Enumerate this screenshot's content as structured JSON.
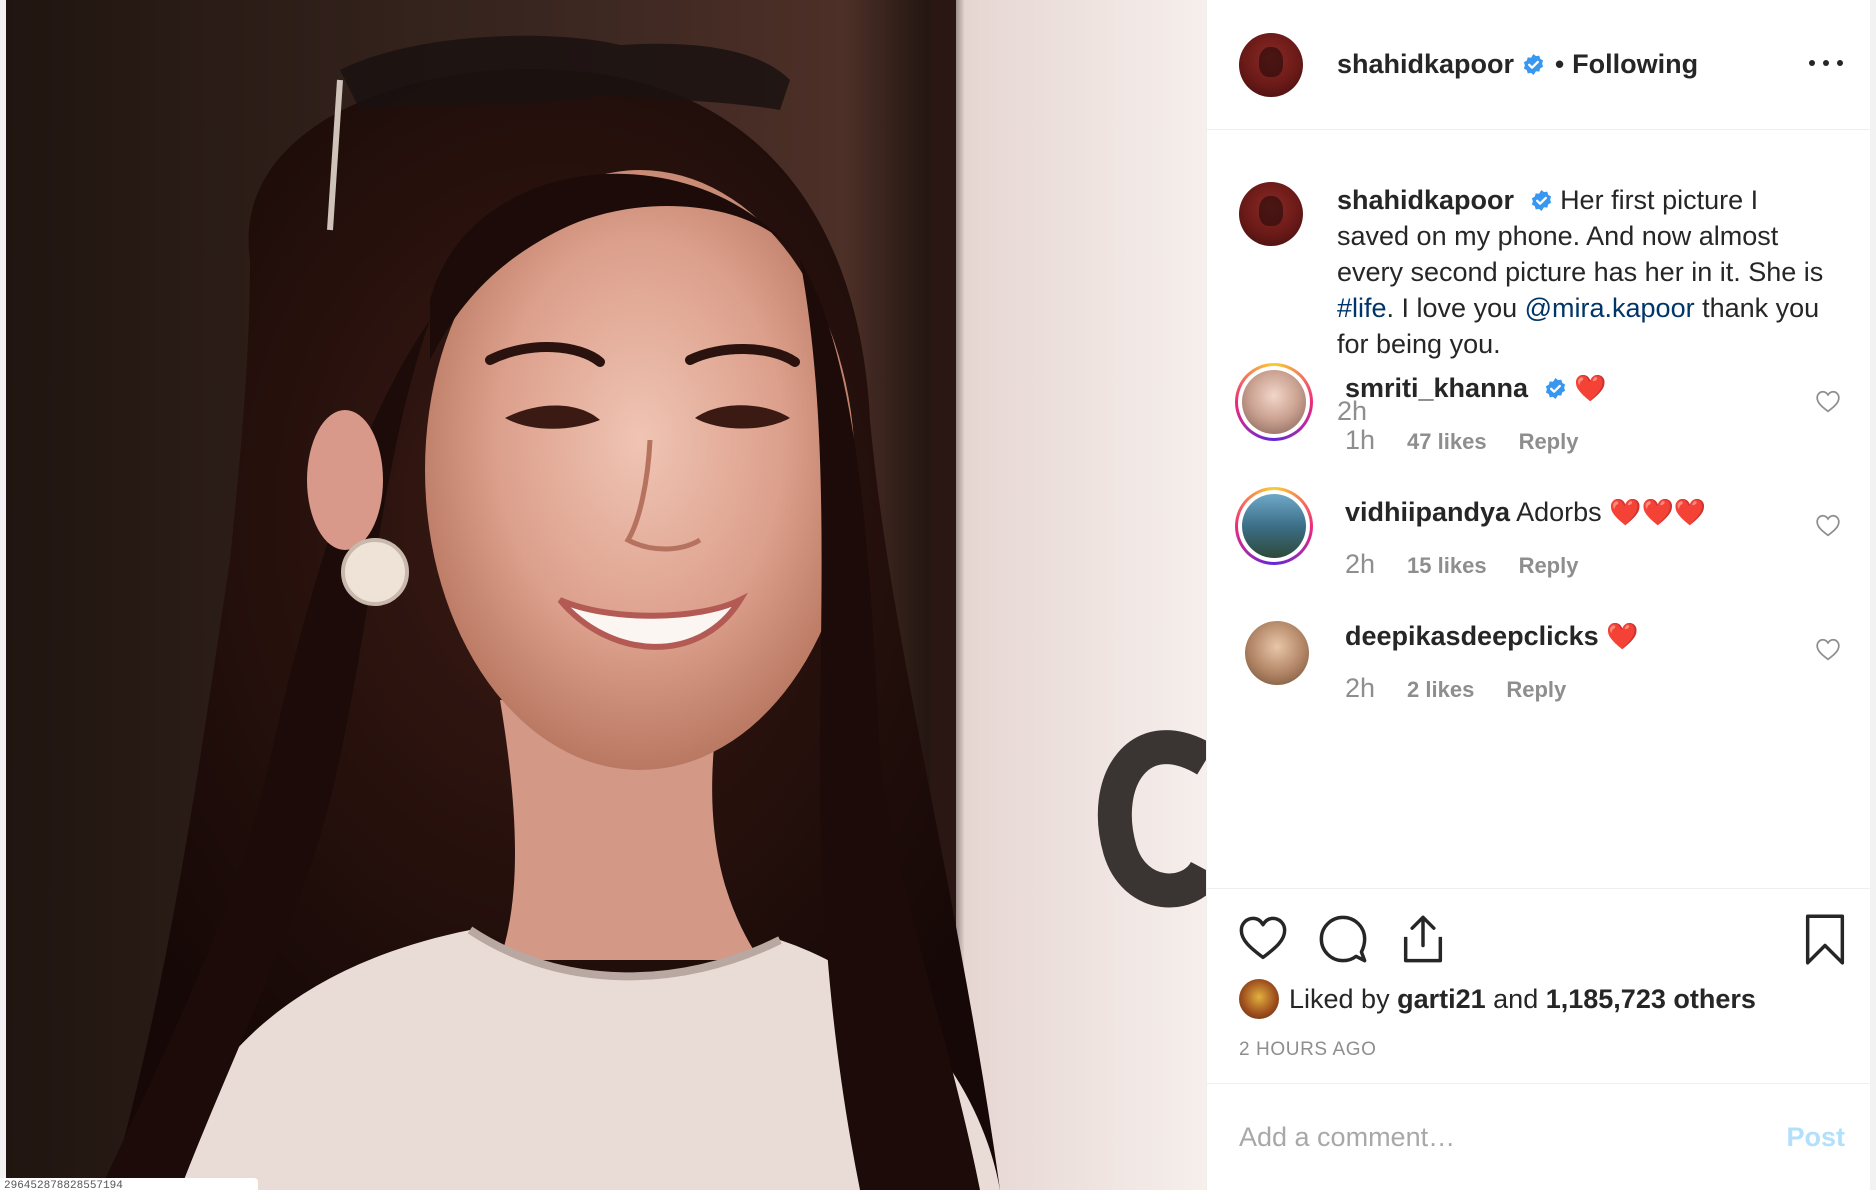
{
  "photo": {
    "overlay_text": "296452878828557194"
  },
  "header": {
    "username": "shahidkapoor",
    "separator": "•",
    "follow_status": "Following"
  },
  "caption": {
    "username": "shahidkapoor",
    "text_before": "Her first picture I saved on my phone. And now almost every second picture has her in it. She is ",
    "hashtag": "#life",
    "text_middle": ". I love you ",
    "mention": "@mira.kapoor",
    "text_after": " thank you for being you.",
    "time": "2h"
  },
  "comments": [
    {
      "username": "smriti_khanna",
      "verified": true,
      "text": "",
      "emoji": "❤️",
      "time": "1h",
      "likes": "47 likes",
      "reply": "Reply"
    },
    {
      "username": "vidhiipandya",
      "verified": false,
      "text": "Adorbs",
      "emoji": "❤️❤️❤️",
      "time": "2h",
      "likes": "15 likes",
      "reply": "Reply"
    },
    {
      "username": "deepikasdeepclicks",
      "verified": false,
      "text": "",
      "emoji": "❤️",
      "time": "2h",
      "likes": "2 likes",
      "reply": "Reply"
    }
  ],
  "actions": {
    "liked_by_prefix": "Liked by",
    "liked_by_user": "garti21",
    "liked_by_and": "and",
    "liked_by_others": "1,185,723 others",
    "timestamp": "2 HOURS AGO"
  },
  "add_comment": {
    "placeholder": "Add a comment…",
    "post_label": "Post"
  },
  "colors": {
    "verified_blue": "#3897f0",
    "link_blue": "#003569",
    "post_disabled": "#b2dffc",
    "heart_red": "#e6212c"
  },
  "icons": [
    "verified-badge-icon",
    "more-options-icon",
    "heart-icon",
    "comment-icon",
    "share-icon",
    "bookmark-icon"
  ]
}
